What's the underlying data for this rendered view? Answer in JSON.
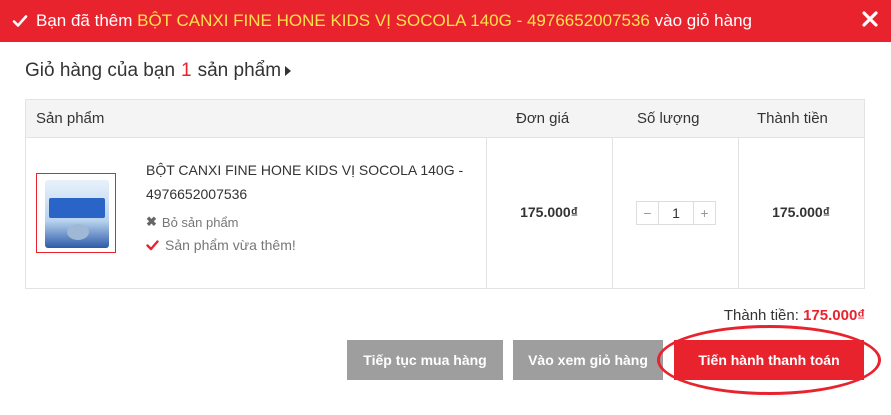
{
  "banner": {
    "prefix": "Bạn đã thêm ",
    "product": "BỘT CANXI FINE HONE KIDS VỊ SOCOLA 140G - 4976652007536",
    "suffix": " vào giỏ hàng",
    "color": "#e9232e",
    "highlight_color": "#ffe14d"
  },
  "cart": {
    "title_prefix": "Giỏ hàng của bạn",
    "count": "1",
    "title_suffix": "sản phẩm"
  },
  "table": {
    "headers": {
      "product": "Sản phẩm",
      "price": "Đơn giá",
      "qty": "Số lượng",
      "total": "Thành tiền"
    },
    "rows": [
      {
        "name": "BỘT CANXI FINE HONE KIDS VỊ SOCOLA 140G - 4976652007536",
        "remove_label": "Bỏ sản phẩm",
        "added_label": "Sản phẩm vừa thêm!",
        "price": "175.000₫",
        "quantity": "1",
        "total": "175.000₫"
      }
    ]
  },
  "summary": {
    "label": "Thành tiền:",
    "amount": "175.000₫"
  },
  "actions": {
    "continue": "Tiếp tục mua hàng",
    "view_cart": "Vào xem giỏ hàng",
    "checkout": "Tiến hành thanh toán"
  },
  "icons": {
    "banner_check": "check-icon",
    "banner_close": "close-icon",
    "remove": "x-icon",
    "added": "checkmark-icon",
    "title_arrow": "caret-right-icon"
  }
}
